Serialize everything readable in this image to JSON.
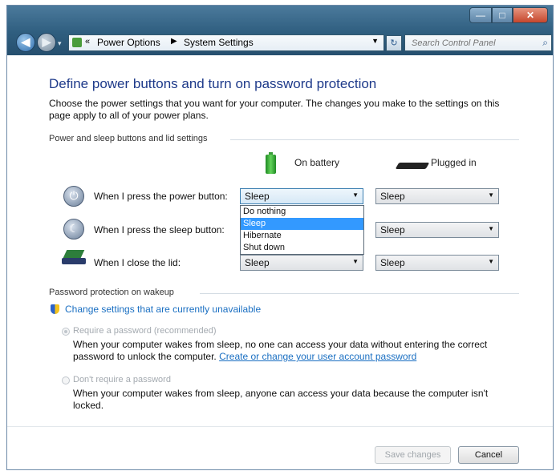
{
  "window": {
    "controls": {
      "minimize": "—",
      "maximize": "□",
      "close": "✕"
    }
  },
  "nav": {
    "back_icon": "back-arrow-icon",
    "forward_icon": "forward-arrow-icon",
    "history_chevron": "▾",
    "address": {
      "crumb_sep": "«",
      "crumbs": [
        "Power Options",
        "System Settings"
      ],
      "crumb_arrow": "▶",
      "dropdown_glyph": "▼"
    },
    "refresh_glyph": "↻",
    "search_placeholder": "Search Control Panel",
    "search_glyph": "⌕"
  },
  "page": {
    "heading": "Define power buttons and turn on password protection",
    "description": "Choose the power settings that you want for your computer. The changes you make to the settings on this page apply to all of your power plans.",
    "section_buttons": "Power and sleep buttons and lid settings",
    "col_battery": "On battery",
    "col_plugged": "Plugged in",
    "rows": [
      {
        "label": "When I press the power button:",
        "battery": "Sleep",
        "plugged": "Sleep",
        "icon": "power-icon"
      },
      {
        "label": "When I press the sleep button:",
        "battery": "Sleep",
        "plugged": "Sleep",
        "icon": "sleep-moon-icon"
      },
      {
        "label": "When I close the lid:",
        "battery": "Sleep",
        "plugged": "Sleep",
        "icon": "laptop-lid-icon"
      }
    ],
    "combo_arrow": "▼",
    "dropdown_options": [
      "Do nothing",
      "Sleep",
      "Hibernate",
      "Shut down"
    ],
    "dropdown_selected": "Sleep",
    "section_password": "Password protection on wakeup",
    "change_settings_link": "Change settings that are currently unavailable",
    "require_password": {
      "label": "Require a password (recommended)",
      "text": "When your computer wakes from sleep, no one can access your data without entering the correct password to unlock the computer.",
      "link": "Create or change your user account password"
    },
    "no_password": {
      "label": "Don't require a password",
      "text": "When your computer wakes from sleep, anyone can access your data because the computer isn't locked."
    }
  },
  "footer": {
    "save_label": "Save changes",
    "cancel_label": "Cancel"
  }
}
